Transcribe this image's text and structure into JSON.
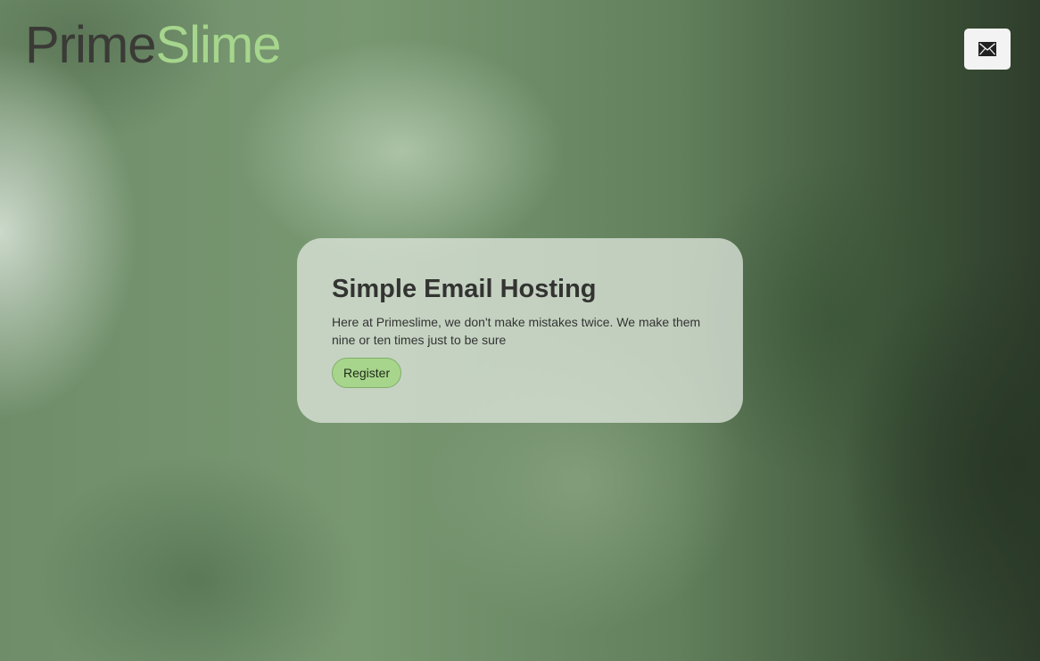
{
  "header": {
    "logo_part1": "Prime",
    "logo_part2": "Slime",
    "mail_button_icon": "envelope-icon"
  },
  "hero": {
    "title": "Simple Email Hosting",
    "text": "Here at Primeslime, we don't make mistakes twice. We make them nine or ten times just to be sure",
    "register_label": "Register"
  },
  "colors": {
    "logo_dark": "#3a3a36",
    "logo_accent": "#a6d68d",
    "button_green": "#a7d58b",
    "card_bg": "#dce4da"
  }
}
